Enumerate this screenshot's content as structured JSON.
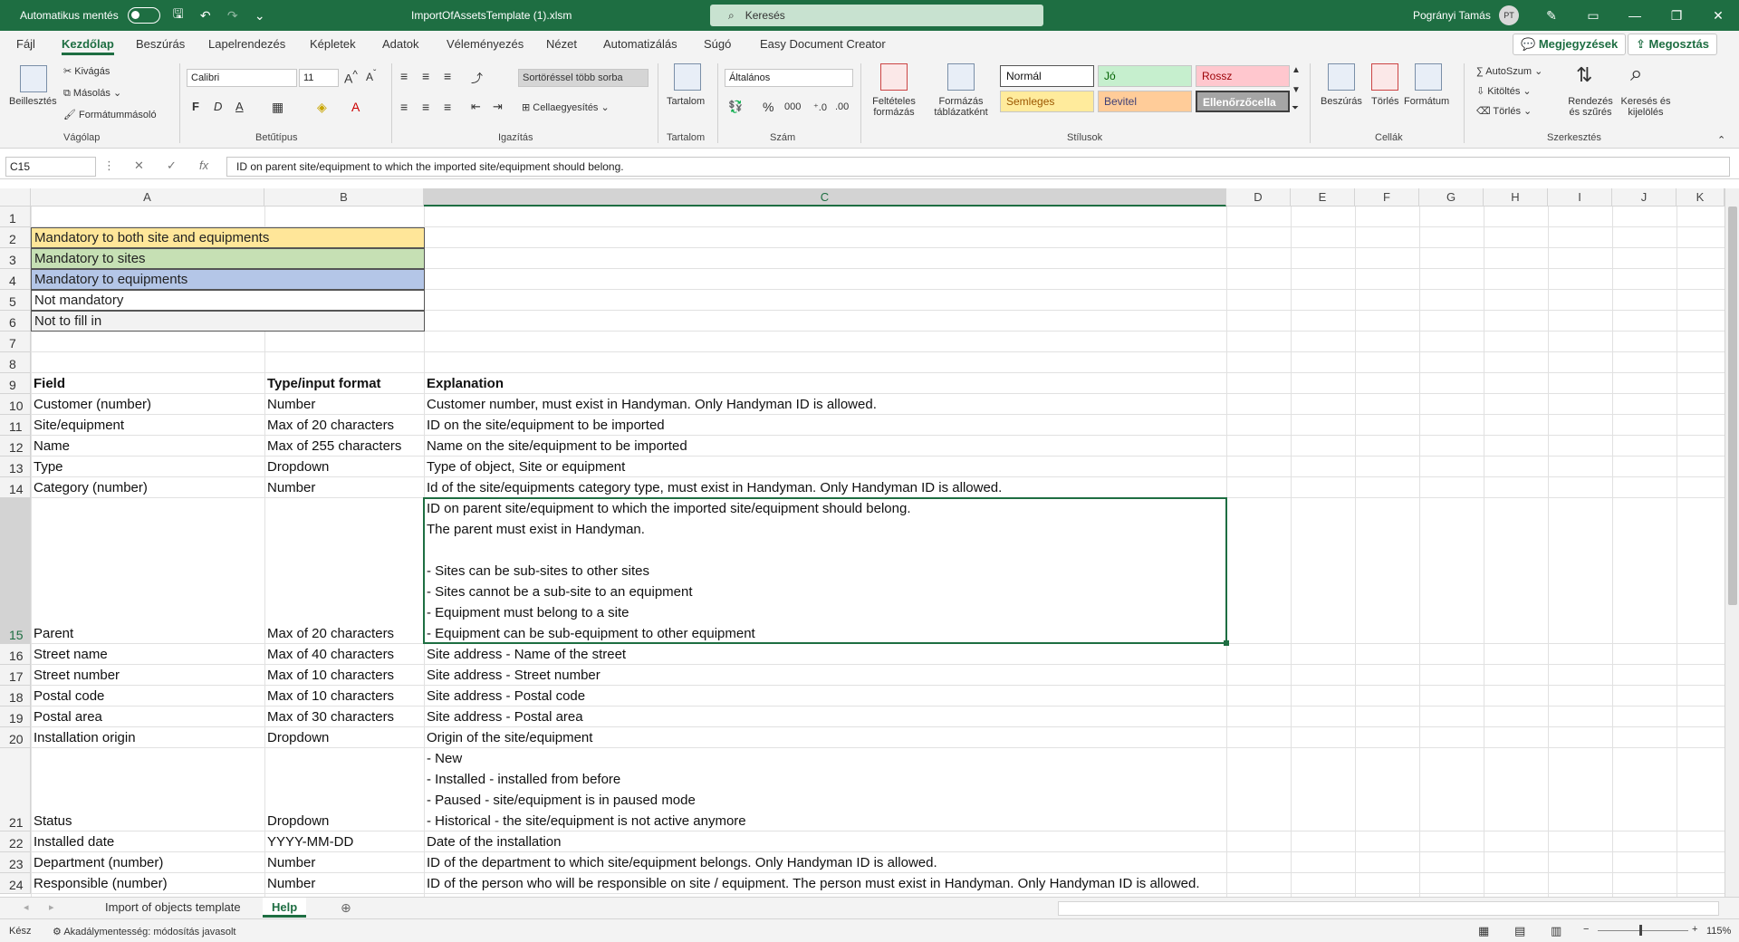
{
  "window": {
    "autosave_label": "Automatikus mentés",
    "filename": "ImportOfAssetsTemplate (1).xlsm",
    "search_placeholder": "Keresés",
    "user_name": "Pogrányi Tamás",
    "user_initials": "PT"
  },
  "menu": {
    "tabs": [
      "Fájl",
      "Kezdőlap",
      "Beszúrás",
      "Lapelrendezés",
      "Képletek",
      "Adatok",
      "Véleményezés",
      "Nézet",
      "Automatizálás",
      "Súgó",
      "Easy Document Creator"
    ],
    "comments_btn": "Megjegyzések",
    "share_btn": "Megosztás"
  },
  "ribbon": {
    "paste": "Beillesztés",
    "cut": "Kivágás",
    "copy": "Másolás",
    "format_painter": "Formátummásoló",
    "clipboard": "Vágólap",
    "font_name": "Calibri",
    "font_size": "11",
    "bold": "F",
    "italic": "D",
    "underline": "A",
    "font": "Betűtípus",
    "wrap": "Sortöréssel több sorba",
    "merge": "Cellaegyesítés",
    "alignment": "Igazítás",
    "content": "Tartalom",
    "content_group": "Tartalom",
    "number_format": "Általános",
    "number": "Szám",
    "conditional": "Feltételes formázás",
    "format_table": "Formázás táblázatként",
    "styles_group": "Stílusok",
    "styles": {
      "normal": "Normál",
      "good": "Jó",
      "bad": "Rossz",
      "neutral": "Semleges",
      "input": "Bevitel",
      "check": "Ellenőrzőcella"
    },
    "insert": "Beszúrás",
    "delete": "Törlés",
    "format": "Formátum",
    "cells": "Cellák",
    "autosum": "AutoSzum",
    "fill": "Kitöltés",
    "clear": "Törlés",
    "sort_filter": "Rendezés és szűrés",
    "find_select": "Keresés és kijelölés",
    "editing": "Szerkesztés"
  },
  "formula": {
    "name_box": "C15",
    "fx": "fx",
    "content": "ID on parent site/equipment to which the imported site/equipment should belong."
  },
  "columns": [
    "A",
    "B",
    "C",
    "D",
    "E",
    "F",
    "G",
    "H",
    "I",
    "J",
    "K"
  ],
  "rows": [
    "1",
    "2",
    "3",
    "4",
    "5",
    "6",
    "7",
    "8",
    "9",
    "10",
    "11",
    "12",
    "13",
    "14",
    "15",
    "16",
    "17",
    "18",
    "19",
    "20",
    "21",
    "22",
    "23",
    "24"
  ],
  "legend": [
    {
      "label": "Mandatory to both site and equipments",
      "color": "#ffe699"
    },
    {
      "label": "Mandatory to sites",
      "color": "#c6e0b4"
    },
    {
      "label": "Mandatory to equipments",
      "color": "#b4c6e7"
    },
    {
      "label": "Not mandatory",
      "color": "#ffffff"
    },
    {
      "label": "Not to fill in",
      "color": "#f2f2f2"
    }
  ],
  "header": {
    "field": "Field",
    "type": "Type/input format",
    "explanation": "Explanation"
  },
  "table": [
    {
      "row": 10,
      "field": "Customer (number)",
      "type": "Number",
      "explanation": "Customer number, must exist in Handyman. Only Handyman ID is allowed."
    },
    {
      "row": 11,
      "field": "Site/equipment",
      "type": "Max of 20 characters",
      "explanation": "ID on the site/equipment to be imported"
    },
    {
      "row": 12,
      "field": "Name",
      "type": "Max of 255 characters",
      "explanation": "Name on the site/equipment to be imported"
    },
    {
      "row": 13,
      "field": "Type",
      "type": "Dropdown",
      "explanation": "Type of object, Site or equipment"
    },
    {
      "row": 14,
      "field": "Category (number)",
      "type": "Number",
      "explanation": "Id of the site/equipments category type, must exist in Handyman. Only Handyman ID is allowed."
    },
    {
      "row": 15,
      "field": "Parent",
      "type": "Max of 20 characters",
      "explanation": "ID on parent site/equipment to which the imported site/equipment should belong.\nThe parent must exist in Handyman.\n\n- Sites can be sub-sites to other sites\n- Sites cannot be a sub-site to an equipment\n- Equipment must belong to a site\n- Equipment can be sub-equipment to other equipment"
    },
    {
      "row": 16,
      "field": "Street name",
      "type": "Max of 40 characters",
      "explanation": "Site address - Name of the street"
    },
    {
      "row": 17,
      "field": "Street number",
      "type": "Max of 10 characters",
      "explanation": "Site address - Street number"
    },
    {
      "row": 18,
      "field": "Postal code",
      "type": "Max of 10 characters",
      "explanation": "Site address - Postal code"
    },
    {
      "row": 19,
      "field": "Postal area",
      "type": "Max of 30 characters",
      "explanation": "Site address - Postal area"
    },
    {
      "row": 20,
      "field": "Installation origin",
      "type": "Dropdown",
      "explanation": "Origin of the site/equipment"
    },
    {
      "row": 21,
      "field": "Status",
      "type": "Dropdown",
      "explanation": "- New\n- Installed - installed from before\n- Paused - site/equipment is in paused mode\n- Historical - the site/equipment is not active anymore"
    },
    {
      "row": 22,
      "field": "Installed date",
      "type": "YYYY-MM-DD",
      "explanation": "Date of the installation"
    },
    {
      "row": 23,
      "field": "Department (number)",
      "type": "Number",
      "explanation": "ID of the department to which site/equipment belongs. Only Handyman ID is allowed."
    },
    {
      "row": 24,
      "field": "Responsible (number)",
      "type": "Number",
      "explanation": "ID of the person who will be responsible on site / equipment. The person must exist in Handyman. Only Handyman ID is allowed."
    }
  ],
  "sheets": [
    "Import of objects template",
    "Help"
  ],
  "status": {
    "ready": "Kész",
    "accessibility": "Akadálymentesség: módosítás javasolt",
    "zoom": "115%"
  },
  "colors": {
    "accent": "#1e6e42"
  }
}
